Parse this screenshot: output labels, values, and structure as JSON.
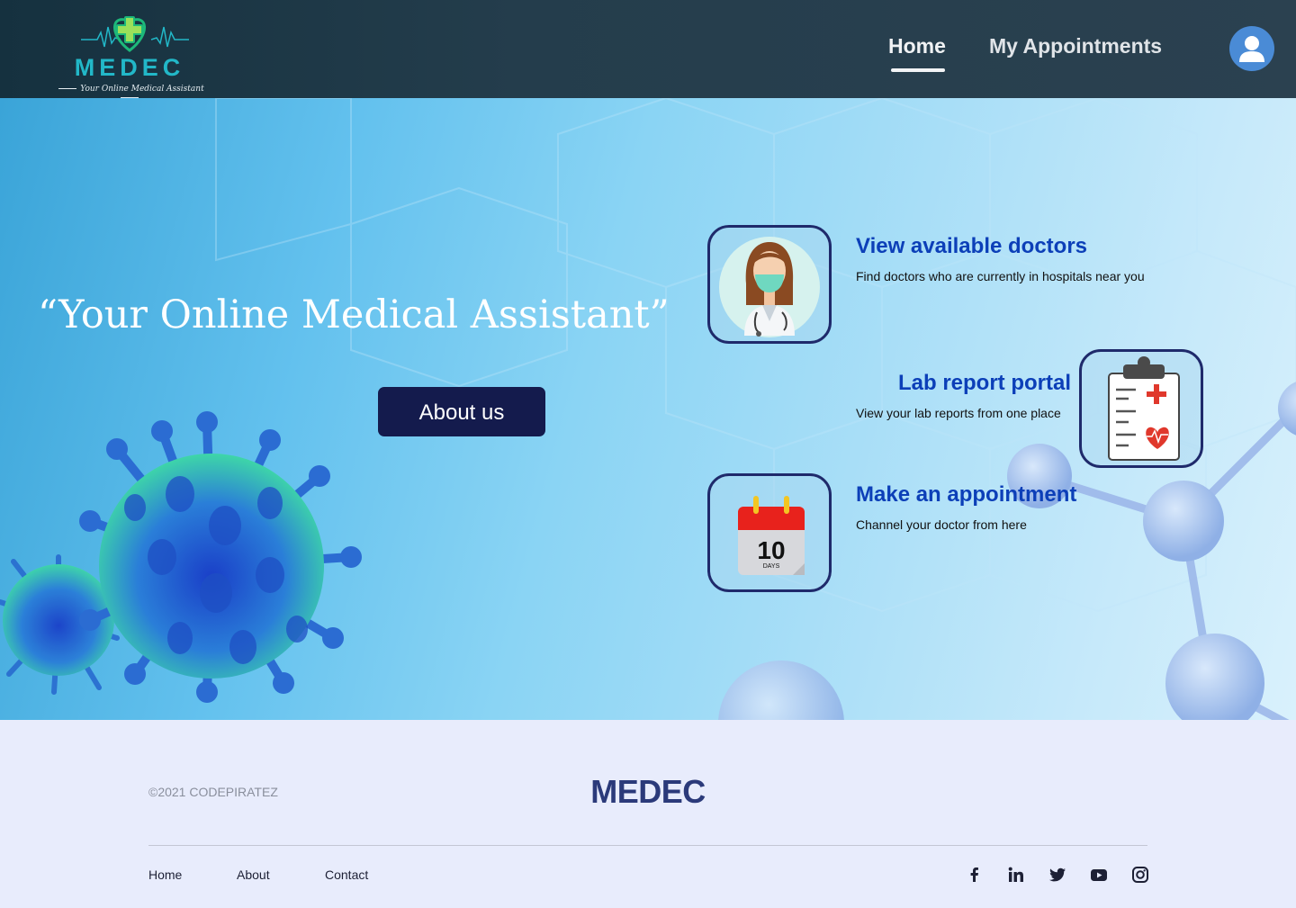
{
  "header": {
    "logo_text": "MEDEC",
    "logo_tagline": "Your Online Medical Assistant",
    "nav": [
      {
        "label": "Home",
        "active": true
      },
      {
        "label": "My Appointments",
        "active": false
      }
    ],
    "avatar_icon": "user-avatar-icon"
  },
  "hero": {
    "tagline": "“Your Online Medical Assistant”",
    "about_button": "About us",
    "cards": [
      {
        "title": "View available doctors",
        "description": "Find doctors who are currently in hospitals near you",
        "icon": "doctor-icon"
      },
      {
        "title": "Lab report portal",
        "description": "View your lab reports from one place",
        "icon": "clipboard-icon"
      },
      {
        "title": "Make an appointment",
        "description": "Channel your doctor from here",
        "icon": "calendar-icon"
      }
    ],
    "calendar": {
      "day": "10",
      "unit": "DAYS"
    }
  },
  "footer": {
    "copyright": "©2021 CODEPIRATEZ",
    "brand": "MEDEC",
    "links": [
      "Home",
      "About",
      "Contact"
    ],
    "social": [
      "facebook-icon",
      "linkedin-icon",
      "twitter-icon",
      "youtube-icon",
      "instagram-icon"
    ]
  },
  "colors": {
    "header_bg": "#1d3746",
    "button_bg": "#141b4d",
    "card_title": "#0c3fb8",
    "footer_bg": "#e8ecfc",
    "footer_brand": "#2b3a7a"
  }
}
